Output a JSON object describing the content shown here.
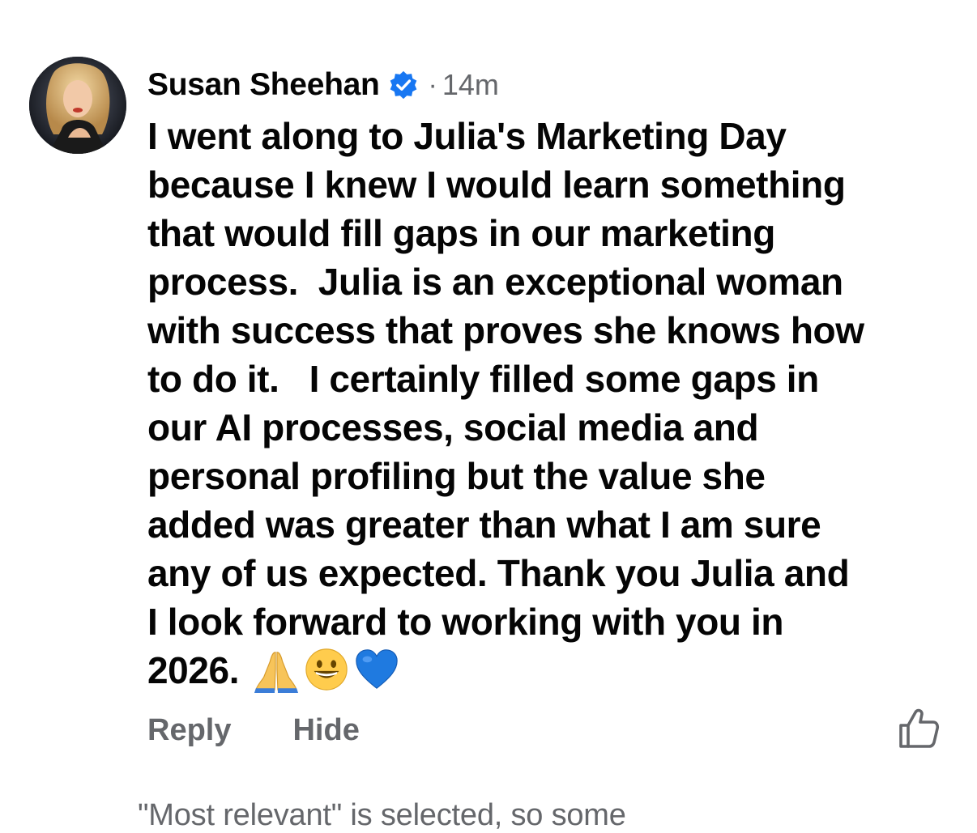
{
  "comment": {
    "author": "Susan Sheehan",
    "time_separator": "·",
    "timestamp": "14m",
    "text_lines": [
      "I went along to Julia's Marketing Day",
      "because I knew I would learn something",
      "that would fill gaps in our marketing",
      "process.  Julia is an exceptional woman",
      "with success that proves she knows how",
      "to do it.   I certainly filled some gaps in",
      "our AI processes, social media and",
      "personal profiling but the value she",
      "added was greater than what I am sure",
      "any of us expected. Thank you Julia and",
      "I look forward to working with you in",
      "2026. "
    ],
    "emojis": [
      "praying-hands-emoji",
      "grinning-face-emoji",
      "blue-heart-emoji"
    ],
    "actions": {
      "reply_label": "Reply",
      "hide_label": "Hide"
    },
    "icons": {
      "verified": "verified-badge-icon",
      "like": "thumbs-up-icon"
    }
  },
  "footer": {
    "note": "\"Most relevant\" is selected, so some"
  },
  "colors": {
    "text_primary": "#050505",
    "text_secondary": "#65676b",
    "verified_blue": "#1877f2",
    "background": "#ffffff"
  }
}
